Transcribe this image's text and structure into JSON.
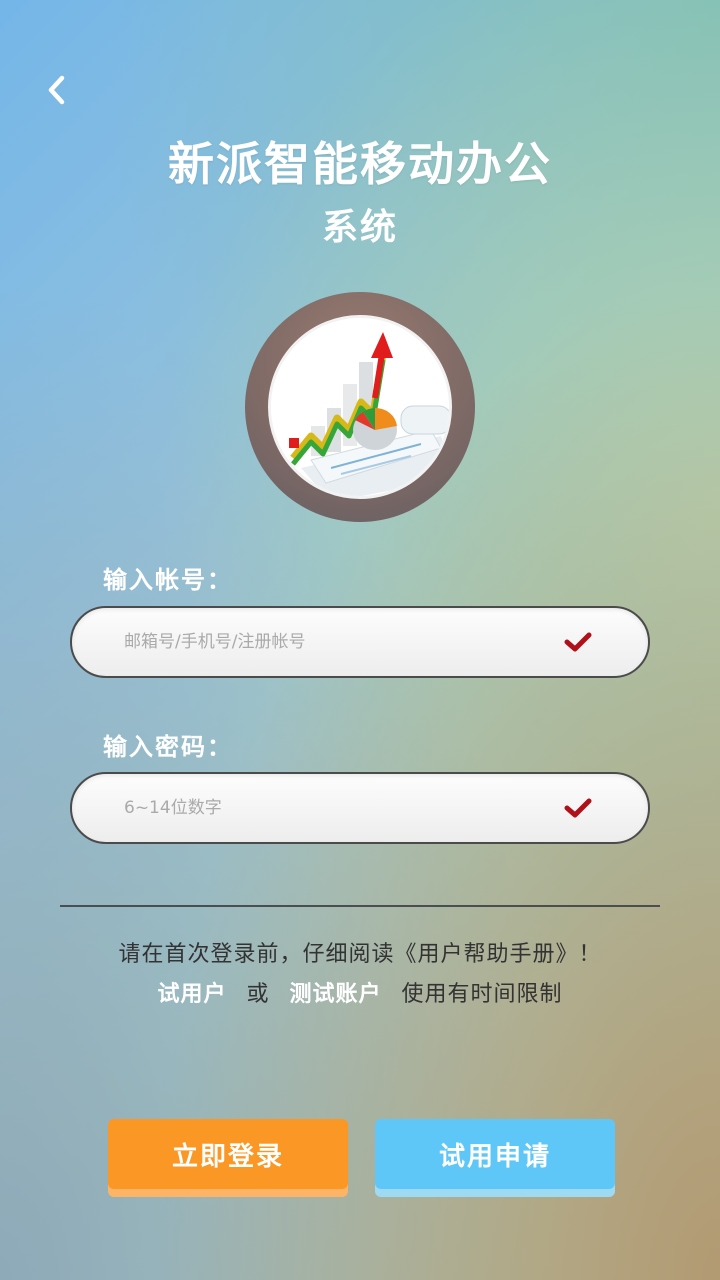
{
  "header": {
    "back_icon": "chevron-left-icon",
    "title": "新派智能移动办公",
    "subtitle": "系统"
  },
  "logo": {
    "icon": "business-chart-icon"
  },
  "account": {
    "label": "输入帐号：",
    "placeholder": "邮箱号/手机号/注册帐号",
    "value": "",
    "status_icon": "checkmark-icon"
  },
  "password": {
    "label": "输入密码：",
    "placeholder": "6~14位数字",
    "value": "",
    "status_icon": "checkmark-icon"
  },
  "notice": {
    "line1": "请在首次登录前，仔细阅读《用户帮助手册》！",
    "trial_user": "试用户",
    "or": "或",
    "test_account": "测试账户",
    "limit_text": "使用有时间限制"
  },
  "buttons": {
    "login": "立即登录",
    "trial_apply": "试用申请"
  },
  "colors": {
    "login_button": "#fb9725",
    "trial_button": "#5ec7f8",
    "check": "#b0101a"
  }
}
